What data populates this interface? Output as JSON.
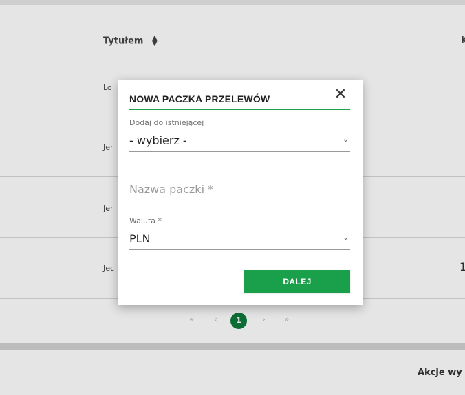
{
  "table": {
    "header_title": "Tytułem",
    "header_right": "K",
    "rows": [
      {
        "title": "Lo",
        "right": ""
      },
      {
        "title": "Jer",
        "right": ""
      },
      {
        "title": "Jer",
        "right": ""
      },
      {
        "title": "Jec",
        "right": "1"
      }
    ]
  },
  "pagination": {
    "first": "«",
    "prev": "‹",
    "current": "1",
    "next": "›",
    "last": "»"
  },
  "bottom": {
    "actions_label": "Akcje wy"
  },
  "modal": {
    "title": "NOWA PACZKA PRZELEWÓW",
    "close_glyph": "✕",
    "existing_label": "Dodaj do istniejącej",
    "existing_value": "- wybierz -",
    "name_placeholder": "Nazwa paczki *",
    "currency_label": "Waluta *",
    "currency_value": "PLN",
    "chevron_glyph": "⌄",
    "next_button": "DALEJ"
  },
  "colors": {
    "accent": "#1aa04a",
    "accent_dark": "#0e7a3a"
  },
  "icons": [
    "sort-icon",
    "close-icon",
    "chevron-down-icon"
  ]
}
